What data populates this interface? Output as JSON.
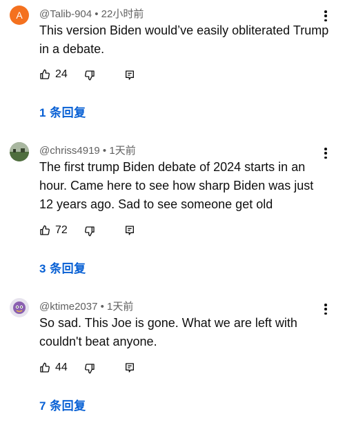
{
  "comments": [
    {
      "avatar_letter": "A",
      "avatar_color": "#f4711f",
      "meta": "@Talib-904 • 22小时前",
      "text": "This version Biden would’ve easily obliterated Trump in a debate.",
      "likes": "24",
      "replies": "1 条回复"
    },
    {
      "avatar_letter": "",
      "meta": "@chriss4919 • 1天前",
      "text": "The first trump Biden debate of 2024 starts in an hour. Came here to see how sharp Biden was just 12 years ago. Sad to see someone get old",
      "likes": "72",
      "replies": "3 条回复"
    },
    {
      "avatar_letter": "",
      "meta": "@ktime2037 • 1天前",
      "text": "So sad. This Joe is gone. What we are left with couldn't beat anyone.",
      "likes": "44",
      "replies": "7 条回复"
    }
  ],
  "icons": {
    "like": "thumbs-up-icon",
    "dislike": "thumbs-down-icon",
    "reply": "reply-comment-icon",
    "more": "more-vertical-icon"
  }
}
